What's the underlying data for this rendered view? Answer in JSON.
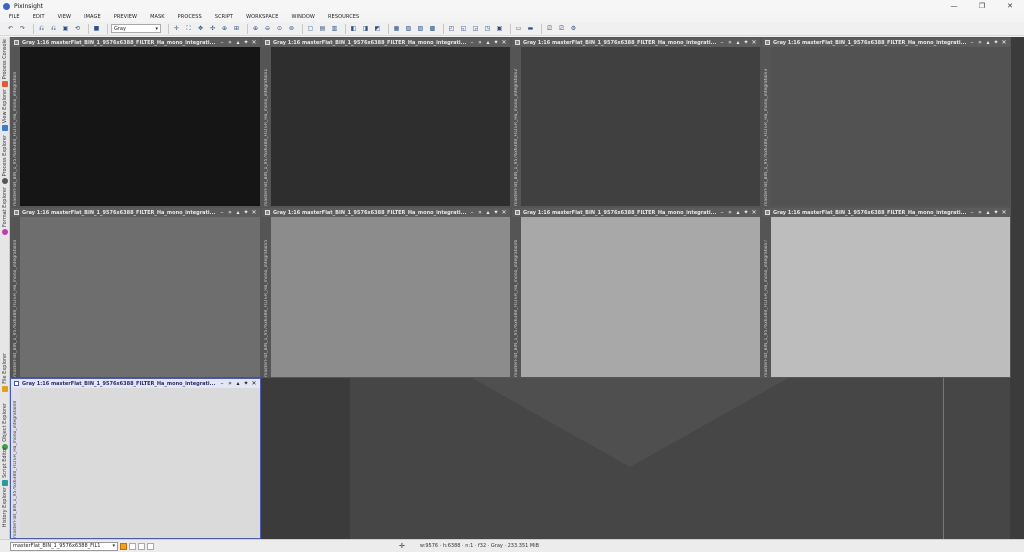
{
  "app": {
    "title": "PixInsight"
  },
  "window_controls": [
    "—",
    "❐",
    "✕"
  ],
  "menu": [
    "FILE",
    "EDIT",
    "VIEW",
    "IMAGE",
    "PREVIEW",
    "MASK",
    "PROCESS",
    "SCRIPT",
    "WORKSPACE",
    "WINDOW",
    "RESOURCES"
  ],
  "toolbar": {
    "view_select": "Gray"
  },
  "left_dock": [
    {
      "label": "Process Console",
      "icon_color": "#e05a3a"
    },
    {
      "label": "View Explorer",
      "icon_color": "#3a7ad0"
    },
    {
      "label": "Process Explorer",
      "icon_color": "#555555"
    },
    {
      "label": "Format Explorer",
      "icon_color": "#c03ab0"
    },
    {
      "label": "File Explorer",
      "icon_color": "#e0a020"
    },
    {
      "label": "Object Explorer",
      "icon_color": "#3aa040"
    },
    {
      "label": "Script Editor",
      "icon_color": "#2a9a9a"
    },
    {
      "label": "History Explorer",
      "icon_color": "#8a8a8a"
    }
  ],
  "windows": [
    {
      "title": "Gray 1:16 masterFlat_BIN_1_9576x6388_FILTER_Ha_mono_integrati...",
      "side_label": "masterFlat_BIN_1_9576x6388_FILTER_Ha_mono_integration",
      "fill": "#151515",
      "active": false
    },
    {
      "title": "Gray 1:16 masterFlat_BIN_1_9576x6388_FILTER_Ha_mono_integrati...",
      "side_label": "masterFlat_BIN_1_9576x6388_FILTER_Ha_mono_integration1",
      "fill": "#2e2e2e",
      "active": false
    },
    {
      "title": "Gray 1:16 masterFlat_BIN_1_9576x6388_FILTER_Ha_mono_integrati...",
      "side_label": "masterFlat_BIN_1_9576x6388_FILTER_Ha_mono_integration2",
      "fill": "#404040",
      "active": false
    },
    {
      "title": "Gray 1:16 masterFlat_BIN_1_9576x6388_FILTER_Ha_mono_integrati...",
      "side_label": "masterFlat_BIN_1_9576x6388_FILTER_Ha_mono_integration3",
      "fill": "#525252",
      "active": false
    },
    {
      "title": "Gray 1:16 masterFlat_BIN_1_9576x6388_FILTER_Ha_mono_integrati...",
      "side_label": "masterFlat_BIN_1_9576x6388_FILTER_Ha_mono_integration4",
      "fill": "#6e6e6e",
      "active": false
    },
    {
      "title": "Gray 1:16 masterFlat_BIN_1_9576x6388_FILTER_Ha_mono_integrati...",
      "side_label": "masterFlat_BIN_1_9576x6388_FILTER_Ha_mono_integration5",
      "fill": "#8c8c8c",
      "active": false
    },
    {
      "title": "Gray 1:16 masterFlat_BIN_1_9576x6388_FILTER_Ha_mono_integrati...",
      "side_label": "masterFlat_BIN_1_9576x6388_FILTER_Ha_mono_integration6",
      "fill": "#a8a8a8",
      "active": false
    },
    {
      "title": "Gray 1:16 masterFlat_BIN_1_9576x6388_FILTER_Ha_mono_integrati...",
      "side_label": "masterFlat_BIN_1_9576x6388_FILTER_Ha_mono_integration7",
      "fill": "#bdbdbd",
      "active": false
    },
    {
      "title": "Gray 1:16 masterFlat_BIN_1_9576x6388_FILTER_Ha_mono_integrati...",
      "side_label": "masterFlat_BIN_1_9576x6388_FILTER_Ha_mono_integration8",
      "fill": "#dadada",
      "active": true
    }
  ],
  "window_buttons": [
    "–",
    "»",
    "▴",
    "✦",
    "✕"
  ],
  "status": {
    "view_select": "masterFlat_BIN_1_9576x6388_FIL1",
    "info": "w:9576 · h:6388 · n:1 · f32 · Gray · 233.351 MiB"
  }
}
